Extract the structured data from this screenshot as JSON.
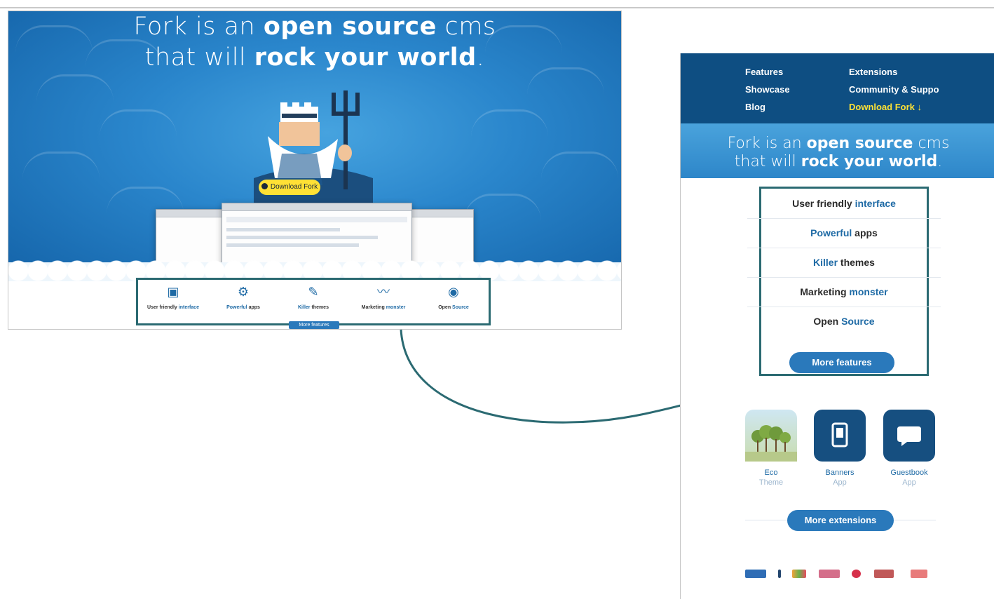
{
  "desktop": {
    "headline_line1": {
      "pre": "Fork is an ",
      "bold": "open source",
      "post": " cms"
    },
    "headline_line2": {
      "pre": "that will ",
      "bold": "rock your world",
      "post": "."
    },
    "download_label": "Download Fork",
    "features": [
      {
        "plain": "User friendly ",
        "highlight": "interface",
        "icon": "monitor-icon"
      },
      {
        "plain": "Powerful apps",
        "highlight": "",
        "icon": "gears-icon"
      },
      {
        "plain": "Killer themes",
        "highlight": "",
        "icon": "brush-icon"
      },
      {
        "plain": "Marketing ",
        "highlight": "monster",
        "icon": "pulse-icon"
      },
      {
        "plain": "Open ",
        "highlight": "Source",
        "icon": "open-source-icon"
      }
    ],
    "more_features_label": "More features"
  },
  "mobile": {
    "nav": {
      "col1": [
        "Features",
        "Showcase",
        "Blog"
      ],
      "col2": [
        "Extensions",
        "Community & Suppo",
        "Download Fork ↓"
      ]
    },
    "hero_line1": {
      "pre": "Fork is an ",
      "bold": "open source",
      "post": " cms"
    },
    "hero_line2": {
      "pre": "that will ",
      "bold": "rock your world",
      "post": "."
    },
    "features": [
      {
        "plain": "User friendly ",
        "highlight": "interface",
        "order": "plain-first"
      },
      {
        "plain": " apps",
        "highlight": "Powerful",
        "order": "highlight-first"
      },
      {
        "plain": " themes",
        "highlight": "Killer",
        "order": "highlight-first"
      },
      {
        "plain": "Marketing ",
        "highlight": "monster",
        "order": "plain-first"
      },
      {
        "plain": "Open ",
        "highlight": "Source",
        "order": "plain-first"
      }
    ],
    "more_features_label": "More features",
    "extensions": [
      {
        "name": "Eco",
        "type": "Theme"
      },
      {
        "name": "Banners",
        "type": "App"
      },
      {
        "name": "Guestbook",
        "type": "App"
      }
    ],
    "more_extensions_label": "More extensions"
  },
  "colors": {
    "accent": "#2a79bb",
    "nav": "#0e4e82",
    "highlight_box": "#2b6a72",
    "download": "#ffe135"
  }
}
